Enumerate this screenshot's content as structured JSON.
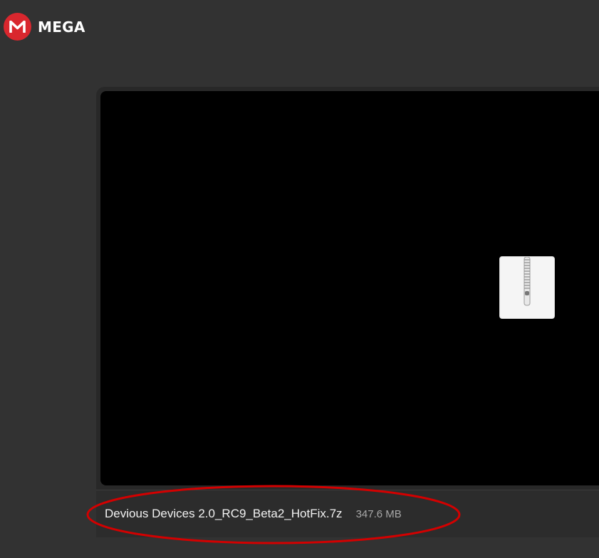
{
  "brand": {
    "name": "MEGA",
    "badge_letter": "M",
    "color": "#d9272e"
  },
  "file": {
    "name": "Devious Devices 2.0_RC9_Beta2_HotFix.7z",
    "size": "347.6 MB",
    "icon": "archive-zip-icon"
  },
  "annotation": {
    "shape": "ellipse",
    "color": "#d40000"
  }
}
